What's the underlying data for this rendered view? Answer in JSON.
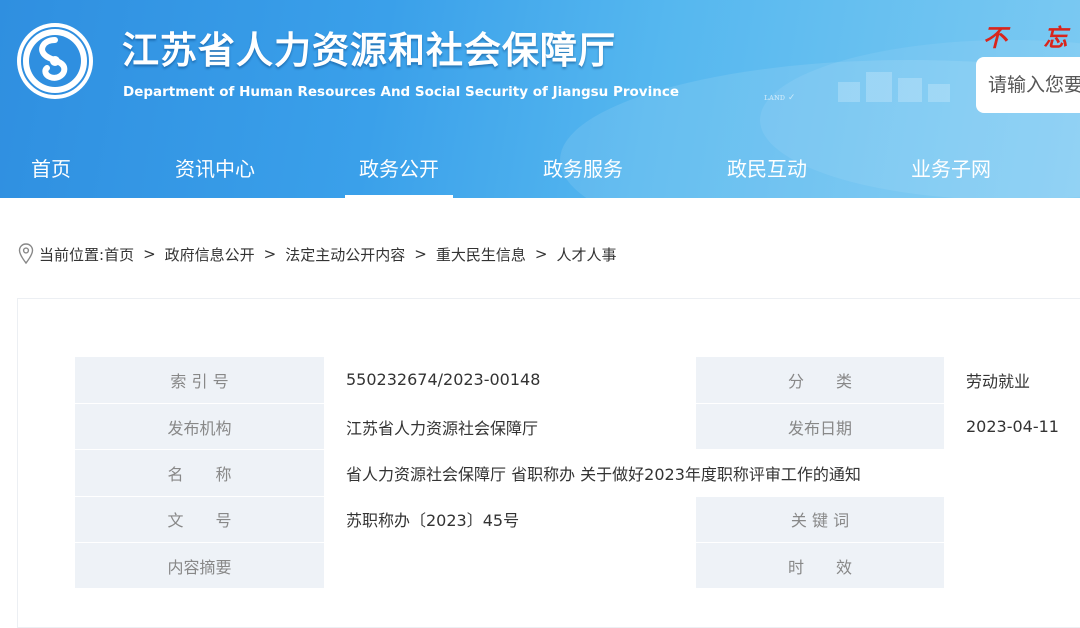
{
  "header": {
    "title_cn": "江苏省人力资源和社会保障厅",
    "title_en": "Department of Human Resources And Social Security of Jiangsu Province",
    "slogan": "不 忘 初",
    "search_placeholder": "请输入您要",
    "brand_color": "#3a9ae6",
    "slogan_color": "#d9251c"
  },
  "nav": {
    "items": [
      {
        "label": "首页"
      },
      {
        "label": "资讯中心"
      },
      {
        "label": "政务公开",
        "active": true
      },
      {
        "label": "政务服务"
      },
      {
        "label": "政民互动"
      },
      {
        "label": "业务子网"
      }
    ]
  },
  "breadcrumb": {
    "prefix": "当前位置:",
    "items": [
      "首页",
      "政府信息公开",
      "法定主动公开内容",
      "重大民生信息",
      "人才人事"
    ],
    "separator": ">"
  },
  "info_table": {
    "rows": [
      {
        "label1": "索 引 号",
        "value1": "550232674/2023-00148",
        "label2": "分　　类",
        "value2": "劳动就业"
      },
      {
        "label1": "发布机构",
        "value1": "江苏省人力资源社会保障厅",
        "label2": "发布日期",
        "value2": "2023-04-11"
      },
      {
        "label1": "名　　称",
        "value1": "省人力资源社会保障厅 省职称办 关于做好2023年度职称评审工作的通知"
      },
      {
        "label1": "文　　号",
        "value1": "苏职称办〔2023〕45号",
        "label2": "关 键 词",
        "value2": ""
      },
      {
        "label1": "内容摘要",
        "value1": "",
        "label2": "时　　效",
        "value2": ""
      }
    ]
  }
}
